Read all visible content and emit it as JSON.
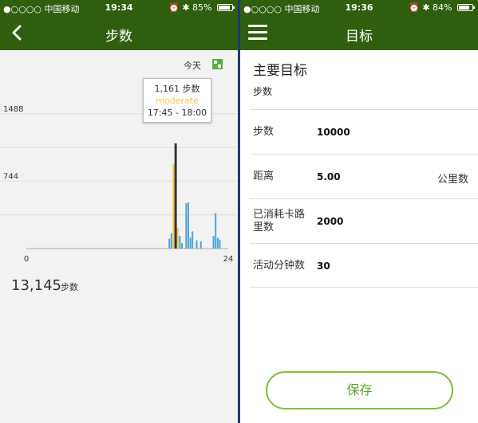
{
  "left": {
    "status": {
      "carrier": "●○○○○ 中国移动",
      "time": "19:34",
      "battery": "85%",
      "battery_level": 0.85
    },
    "nav": {
      "title": "步数"
    },
    "date_label": "今天",
    "tooltip": {
      "steps": "1,161 步数",
      "intensity": "moderate",
      "range": "17:45 - 18:00"
    },
    "total_value": "13,145",
    "total_unit": "步数"
  },
  "right": {
    "status": {
      "carrier": "●○○○○ 中国移动",
      "time": "19:36",
      "battery": "84%",
      "battery_level": 0.84
    },
    "nav": {
      "title": "目标"
    },
    "section_title": "主要目标",
    "section_subtitle": "步数",
    "rows": [
      {
        "label": "步数",
        "value": "10000",
        "unit": ""
      },
      {
        "label": "距离",
        "value": "5.00",
        "unit": "公里数"
      },
      {
        "label": "已消耗卡路里数",
        "value": "2000",
        "unit": ""
      },
      {
        "label": "活动分钟数",
        "value": "30",
        "unit": ""
      }
    ],
    "save_label": "保存"
  },
  "chart_data": {
    "type": "bar",
    "x_range": [
      0,
      24
    ],
    "xticks": [
      "0",
      "24"
    ],
    "ylim": [
      0,
      1900
    ],
    "yticks": [
      744,
      1488
    ],
    "ytick_labels": [
      "744",
      "1488"
    ],
    "grid": true,
    "colors": {
      "active": "#f8c43e",
      "light": "#4ba6d8",
      "selected": "#333333"
    },
    "bars": [
      {
        "hour": 17.0,
        "value": 110,
        "kind": "light"
      },
      {
        "hour": 17.25,
        "value": 170,
        "kind": "light"
      },
      {
        "hour": 17.75,
        "value": 1161,
        "kind": "selected"
      },
      {
        "hour": 17.5,
        "value": 930,
        "kind": "active"
      },
      {
        "hour": 17.75,
        "value": 120,
        "kind": "active"
      },
      {
        "hour": 18.0,
        "value": 230,
        "kind": "active"
      },
      {
        "hour": 18.25,
        "value": 140,
        "kind": "light"
      },
      {
        "hour": 18.5,
        "value": 60,
        "kind": "light"
      },
      {
        "hour": 19.0,
        "value": 500,
        "kind": "light"
      },
      {
        "hour": 19.25,
        "value": 510,
        "kind": "light"
      },
      {
        "hour": 19.5,
        "value": 120,
        "kind": "light"
      },
      {
        "hour": 19.75,
        "value": 190,
        "kind": "light"
      },
      {
        "hour": 20.25,
        "value": 90,
        "kind": "light"
      },
      {
        "hour": 20.75,
        "value": 80,
        "kind": "light"
      },
      {
        "hour": 22.25,
        "value": 140,
        "kind": "light"
      },
      {
        "hour": 22.5,
        "value": 390,
        "kind": "light"
      },
      {
        "hour": 22.75,
        "value": 120,
        "kind": "light"
      },
      {
        "hour": 23.0,
        "value": 100,
        "kind": "light"
      }
    ]
  }
}
